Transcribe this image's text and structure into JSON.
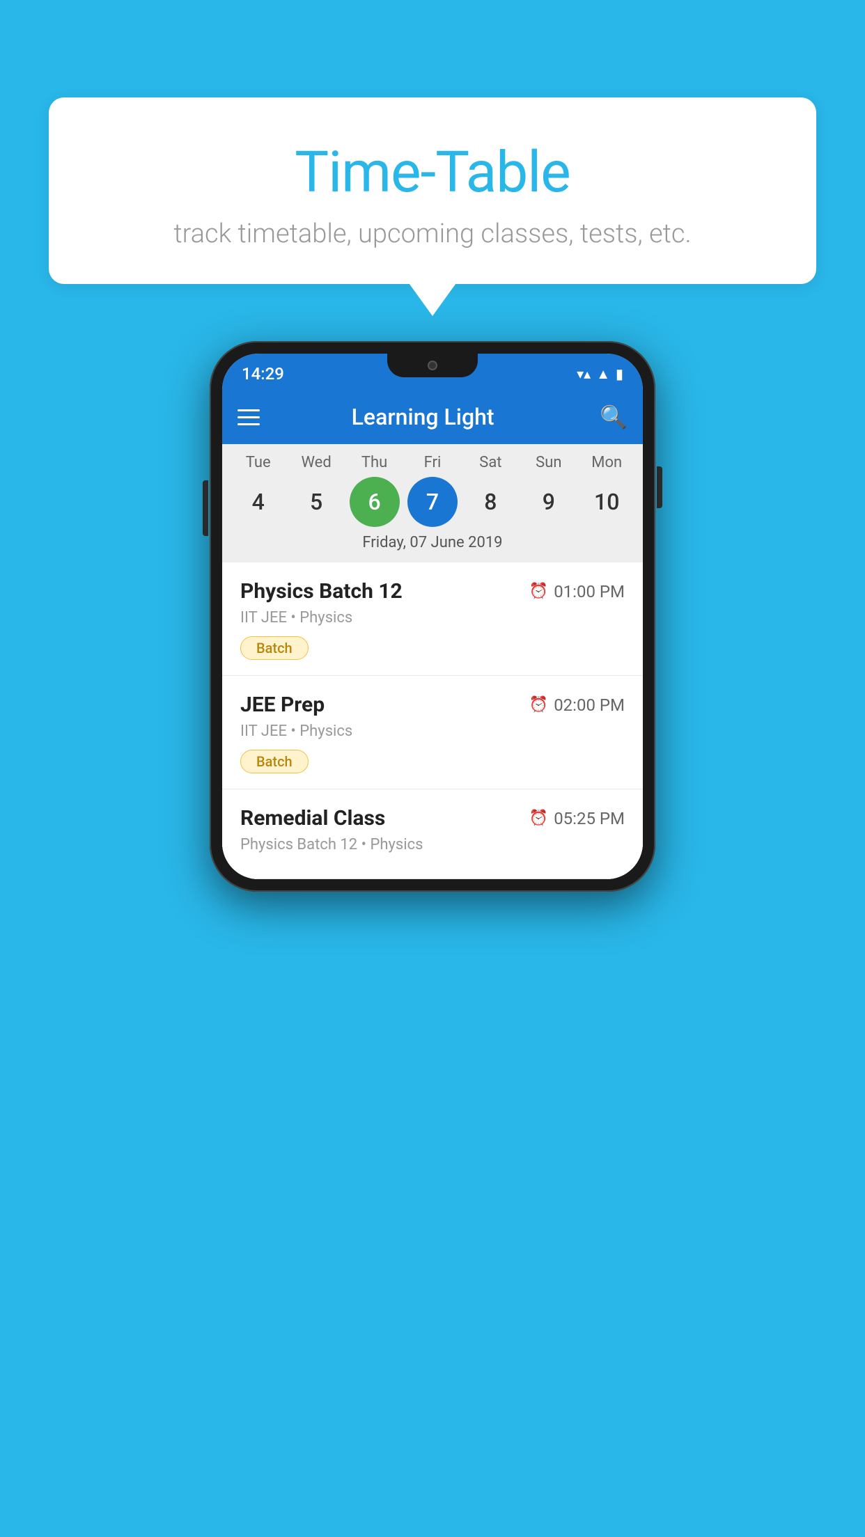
{
  "background_color": "#29B6E8",
  "speech_bubble": {
    "title": "Time-Table",
    "subtitle": "track timetable, upcoming classes, tests, etc."
  },
  "phone": {
    "status_bar": {
      "time": "14:29"
    },
    "app_bar": {
      "title": "Learning Light"
    },
    "calendar": {
      "days": [
        {
          "label": "Tue",
          "number": "4"
        },
        {
          "label": "Wed",
          "number": "5"
        },
        {
          "label": "Thu",
          "number": "6",
          "state": "today"
        },
        {
          "label": "Fri",
          "number": "7",
          "state": "selected"
        },
        {
          "label": "Sat",
          "number": "8"
        },
        {
          "label": "Sun",
          "number": "9"
        },
        {
          "label": "Mon",
          "number": "10"
        }
      ],
      "selected_date_label": "Friday, 07 June 2019"
    },
    "schedule": [
      {
        "class_name": "Physics Batch 12",
        "time": "01:00 PM",
        "meta": "IIT JEE • Physics",
        "badge": "Batch"
      },
      {
        "class_name": "JEE Prep",
        "time": "02:00 PM",
        "meta": "IIT JEE • Physics",
        "badge": "Batch"
      },
      {
        "class_name": "Remedial Class",
        "time": "05:25 PM",
        "meta": "Physics Batch 12 • Physics",
        "badge": null
      }
    ]
  }
}
